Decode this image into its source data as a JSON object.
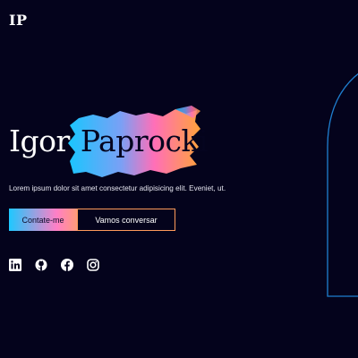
{
  "header": {
    "logo_text": "IP"
  },
  "hero": {
    "first_name": "Igor",
    "last_name": "Paprocki",
    "description": "Lorem ipsum dolor sit amet consectetur adipisicing elit. Eveniet, ut.",
    "contact_button": "Contate-me",
    "talk_button": "Vamos conversar"
  },
  "socials": [
    {
      "icon": "linkedin-icon"
    },
    {
      "icon": "github-icon"
    },
    {
      "icon": "facebook-icon"
    },
    {
      "icon": "instagram-icon"
    }
  ],
  "colors": {
    "background": "#04031c",
    "accent_cyan": "#1ec8ff",
    "accent_pink": "#ff7fc6",
    "accent_orange": "#ff9a5a",
    "arch_outline": "#1f7fd0"
  }
}
